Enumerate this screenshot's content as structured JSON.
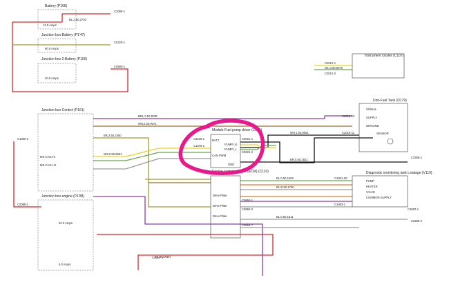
{
  "components": {
    "battery": {
      "title": "Battery (P166)"
    },
    "junction_box_battery": {
      "title": "Junction box-Battery (P1'47)"
    },
    "junction_box_2_battery": {
      "title": "Junction box 2-Battery (P156)"
    },
    "junction_box_control": {
      "title": "Junction box-Control (P161)"
    },
    "junction_box_engine": {
      "title": "Junction box-engine (P1'88)"
    },
    "instrument_cluster": {
      "title": "Instrument cluster (C107)"
    },
    "fuel_tank_unit": {
      "title": "Unit-Fuel Tank (D179)"
    },
    "fuel_pump_module": {
      "title": "Module-Fuel pump driver (C061)",
      "pins": [
        "BATT",
        "GND",
        "PUMP (+)",
        "PUMP (-)",
        "CAN PWM"
      ]
    },
    "engine_control_module": {
      "title": "Engine control module (ECM) (C110)"
    },
    "leak_module": {
      "title": "Diagnostic monitoring tank Leakage (V119)",
      "pins": [
        "PUMP",
        "HEATER",
        "VALVE",
        "COMMON SUPPLY"
      ]
    }
  },
  "fuses": {
    "main": "12.0 Amps",
    "f1": "60.0 Amps",
    "f2": "20.0 Amps",
    "f3": "20.0 Amps",
    "f4": "5.0 Amps"
  },
  "connectors": [
    "C2080-1",
    "C0320-1",
    "C0560-1",
    "C1060-1",
    "C2088-1",
    "C3230-1",
    "C1370-1",
    "C0021-1",
    "C0021-2",
    "C2012-1",
    "C2012-2",
    "C2016-12",
    "C2016-11",
    "C1001-30",
    "C1003-1",
    "C3500-1",
    "C0850-1",
    "C0850-2",
    "C0850-7",
    "C2508-1",
    "C2508-2",
    "C0019-1"
  ],
  "wires": [
    "BL,2.50,2730",
    "BRL,2.50,RGB",
    "WN,2.50,WV1",
    "BR,2.50,1550",
    "WH,1.00,9051",
    "WL,0.50,5670",
    "WS,0.50,9551",
    "BR,0.50,1521",
    "BL,0.50,1560",
    "BU,0.50,1700",
    "BL,0.50,1511"
  ],
  "signals": [
    "MS-CAN HI",
    "MS-CAN LO",
    "SIGNAL",
    "SUPPLY",
    "GROUND",
    "SENSOR",
    "Drive Plate",
    "BL-POWER"
  ],
  "annotation": {
    "highlight_color": "#e8198c"
  },
  "wire_colors": {
    "red": "#d62828",
    "purple": "#8b3fa0",
    "brown": "#9c6a2e",
    "olive": "#a49a2a",
    "black": "#111111",
    "gray": "#9a9a9a",
    "yellow": "#e9d21e",
    "green": "#6aa84f",
    "orange": "#e8772e"
  }
}
